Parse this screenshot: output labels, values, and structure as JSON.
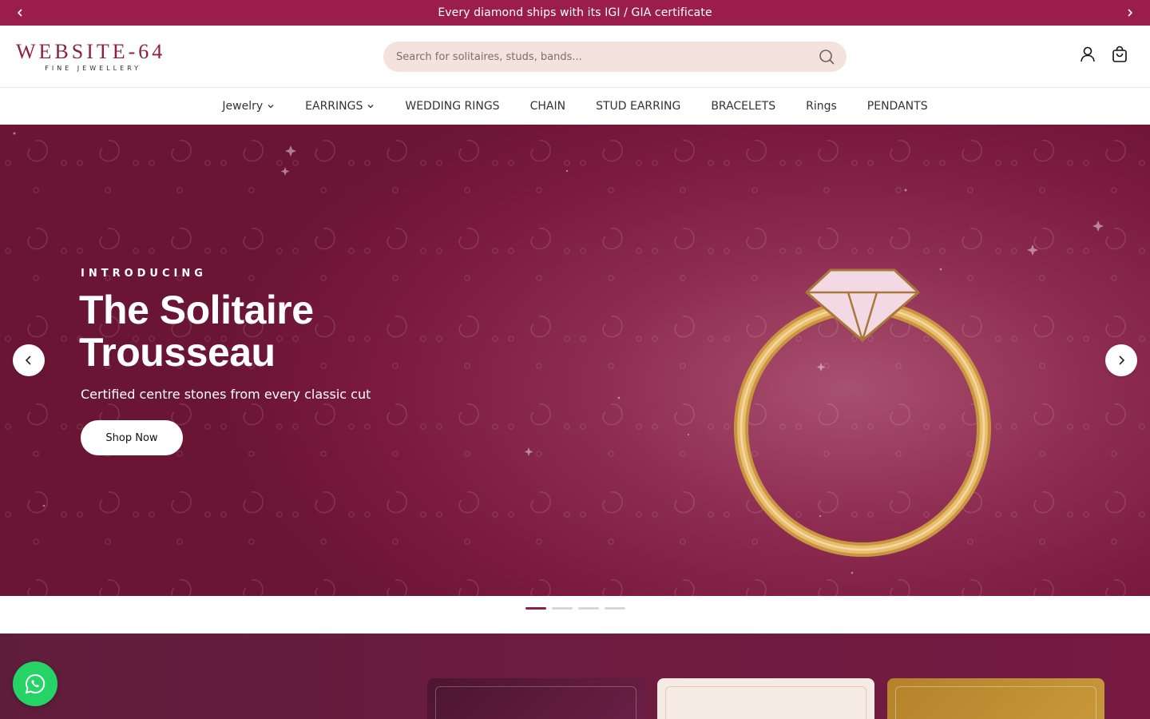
{
  "announcement": {
    "text": "Every diamond ships with its IGI / GIA certificate",
    "prev_icon": "chevron-left-icon",
    "next_icon": "chevron-right-icon"
  },
  "header": {
    "logo_main": "WEBSITE-64",
    "logo_sub": "FINE JEWELLERY",
    "search_placeholder": "Search for solitaires, studs, bands...",
    "search_value": "",
    "icons": [
      "search-icon",
      "account-icon",
      "cart-icon"
    ]
  },
  "nav": {
    "items": [
      {
        "label": "Jewelry",
        "dropdown": true
      },
      {
        "label": "EARRINGS",
        "dropdown": true
      },
      {
        "label": "WEDDING RINGS",
        "dropdown": false
      },
      {
        "label": "CHAIN",
        "dropdown": false
      },
      {
        "label": "STUD EARRING",
        "dropdown": false
      },
      {
        "label": "BRACELETS",
        "dropdown": false
      },
      {
        "label": "Rings",
        "dropdown": false
      },
      {
        "label": "PENDANTS",
        "dropdown": false
      }
    ]
  },
  "hero": {
    "eyebrow": "INTRODUCING",
    "title": "The Solitaire Trousseau",
    "subtitle": "Certified centre stones from every classic cut",
    "cta": "Shop Now",
    "slide_count": 4,
    "active_slide": 1
  },
  "colors": {
    "brand": "#9b1e4a",
    "logo": "#8e1f45",
    "search_bg": "#f4e3dd",
    "gold": "#d9a95a",
    "whatsapp": "#25d366"
  }
}
